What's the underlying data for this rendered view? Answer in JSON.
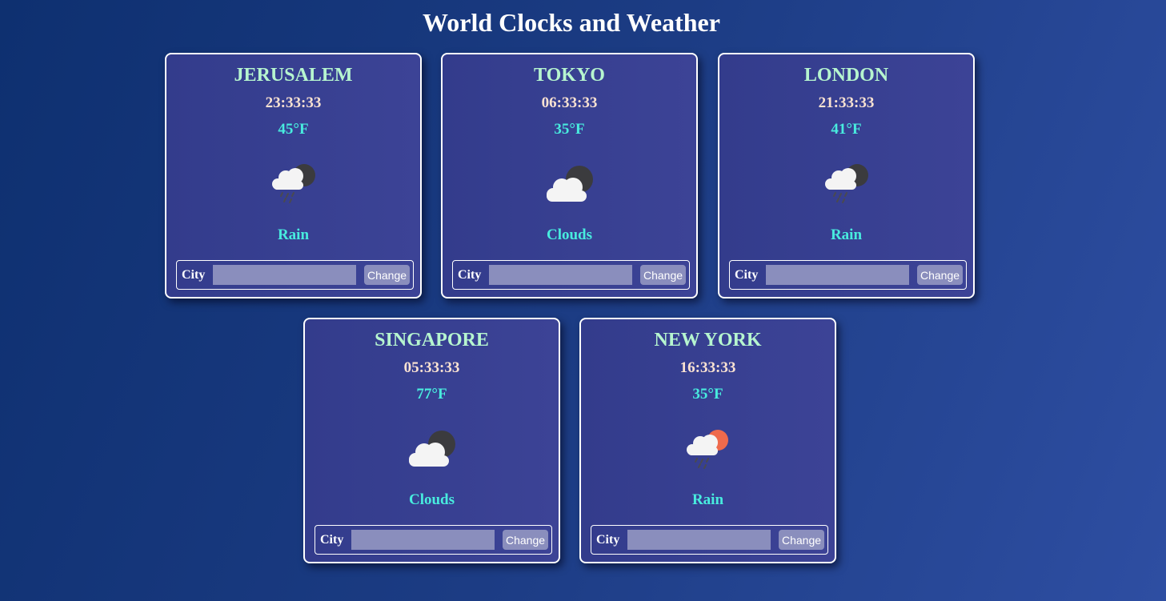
{
  "page": {
    "title": "World Clocks and Weather"
  },
  "colors": {
    "city_name": "#b6f5cf",
    "time": "#fbe3d2",
    "weather_text": "#48ecde",
    "card_border": "#ffffff",
    "control_bg": "#8a8ebd"
  },
  "cards": [
    {
      "city": "JERUSALEM",
      "time": "23:33:33",
      "temperature": "45°F",
      "condition": "Rain",
      "icon": "rain-cloud-night-icon",
      "form": {
        "label": "City",
        "input_value": "",
        "button_label": "Change"
      }
    },
    {
      "city": "TOKYO",
      "time": "06:33:33",
      "temperature": "35°F",
      "condition": "Clouds",
      "icon": "cloud-night-icon",
      "form": {
        "label": "City",
        "input_value": "",
        "button_label": "Change"
      }
    },
    {
      "city": "LONDON",
      "time": "21:33:33",
      "temperature": "41°F",
      "condition": "Rain",
      "icon": "rain-cloud-night-icon",
      "form": {
        "label": "City",
        "input_value": "",
        "button_label": "Change"
      }
    },
    {
      "city": "SINGAPORE",
      "time": "05:33:33",
      "temperature": "77°F",
      "condition": "Clouds",
      "icon": "cloud-night-icon",
      "form": {
        "label": "City",
        "input_value": "",
        "button_label": "Change"
      }
    },
    {
      "city": "NEW YORK",
      "time": "16:33:33",
      "temperature": "35°F",
      "condition": "Rain",
      "icon": "rain-cloud-sun-icon",
      "form": {
        "label": "City",
        "input_value": "",
        "button_label": "Change"
      }
    }
  ]
}
